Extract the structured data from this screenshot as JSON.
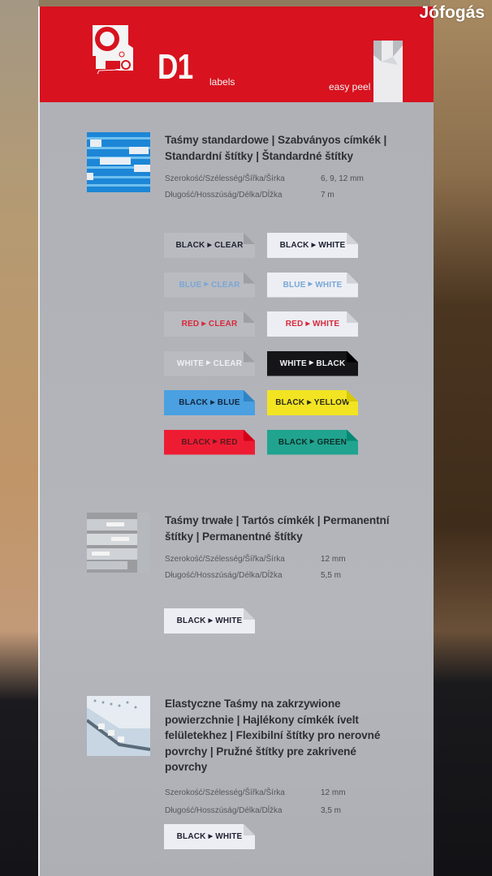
{
  "watermark": "Jófogás",
  "header": {
    "brand": "D1",
    "brand_sub": "labels",
    "tagline": "easy peel",
    "brand_color": "#d8121f"
  },
  "sections": [
    {
      "title": "Taśmy standardowe | Szabványos címkék | Standardní štítky | Štandardné štítky",
      "specs": [
        {
          "label": "Szerokość/Szélesség/Šířka/Šírka",
          "value": "6, 9, 12 mm"
        },
        {
          "label": "Długość/Hosszúság/Délka/Dĺžka",
          "value": "7 m"
        }
      ],
      "tapes": [
        {
          "text": "BLACK",
          "bg": "CLEAR",
          "bg_color": "#b9bbc0",
          "fg_color": "#1e2230"
        },
        {
          "text": "BLACK",
          "bg": "WHITE",
          "bg_color": "#eceef4",
          "fg_color": "#1e2230"
        },
        {
          "text": "BLUE",
          "bg": "CLEAR",
          "bg_color": "#b9bbc0",
          "fg_color": "#7aa7d6"
        },
        {
          "text": "BLUE",
          "bg": "WHITE",
          "bg_color": "#eceef4",
          "fg_color": "#7aa7d6"
        },
        {
          "text": "RED",
          "bg": "CLEAR",
          "bg_color": "#b9bbc0",
          "fg_color": "#d8283a"
        },
        {
          "text": "RED",
          "bg": "WHITE",
          "bg_color": "#eceef4",
          "fg_color": "#d8283a"
        },
        {
          "text": "WHITE",
          "bg": "CLEAR",
          "bg_color": "#b9bbc0",
          "fg_color": "#eef0f4"
        },
        {
          "text": "WHITE",
          "bg": "BLACK",
          "bg_color": "#151517",
          "fg_color": "#eef0f4"
        },
        {
          "text": "BLACK",
          "bg": "BLUE",
          "bg_color": "#4aa0e0",
          "fg_color": "#142540"
        },
        {
          "text": "BLACK",
          "bg": "YELLOW",
          "bg_color": "#f2e422",
          "fg_color": "#2a2a1a"
        },
        {
          "text": "BLACK",
          "bg": "RED",
          "bg_color": "#ee1c33",
          "fg_color": "#5a1a20"
        },
        {
          "text": "BLACK",
          "bg": "GREEN",
          "bg_color": "#20a48f",
          "fg_color": "#0f2d28"
        }
      ]
    },
    {
      "title": "Taśmy trwałe | Tartós címkék | Permanentní štítky | Permanentné štítky",
      "specs": [
        {
          "label": "Szerokość/Szélesség/Šířka/Šírka",
          "value": "12 mm"
        },
        {
          "label": "Długość/Hosszúság/Délka/Dĺžka",
          "value": "5,5 m"
        }
      ],
      "tapes": [
        {
          "text": "BLACK",
          "bg": "WHITE",
          "bg_color": "#eceef4",
          "fg_color": "#1e2230"
        }
      ]
    },
    {
      "title": "Elastyczne Taśmy na zakrzywione powierzchnie | Hajlékony címkék ívelt felületekhez | Flexibilní štítky pro nerovné povrchy | Pružné štítky pre zakrivené povrchy",
      "specs": [
        {
          "label": "Szerokość/Szélesség/Šířka/Šírka",
          "value": "12 mm"
        },
        {
          "label": "Długość/Hosszúság/Délka/Dĺžka",
          "value": "3,5 m"
        }
      ],
      "tapes": [
        {
          "text": "BLACK",
          "bg": "WHITE",
          "bg_color": "#eceef4",
          "fg_color": "#1e2230"
        }
      ]
    }
  ]
}
